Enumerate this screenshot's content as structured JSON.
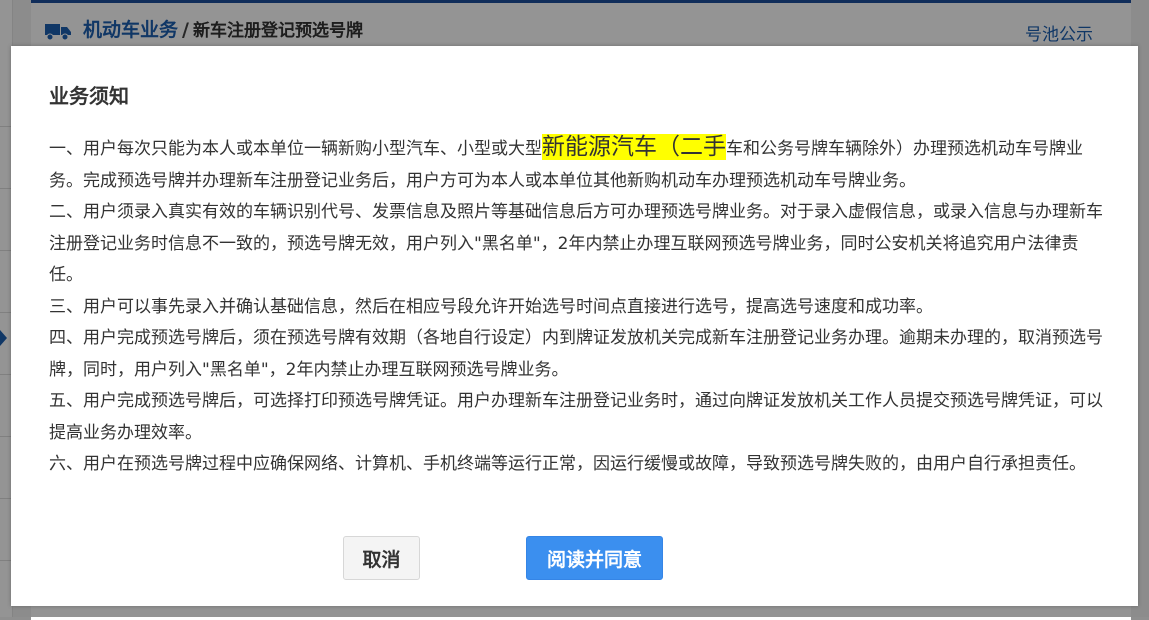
{
  "background": {
    "breadcrumb": {
      "section": "机动车业务",
      "separator": "/",
      "current": "新车注册登记预选号牌"
    },
    "pool_link": "号池公示",
    "icons": [
      "truck-icon"
    ]
  },
  "modal": {
    "title": "业务须知",
    "paragraphs": [
      {
        "before": "一、用户每次只能为本人或本单位一辆新购小型汽车、小型或大型",
        "highlight": "新能源汽车（二手",
        "after": "车和公务号牌车辆除外）办理预选机动车号牌业务。完成预选号牌并办理新车注册登记业务后，用户方可为本人或本单位其他新购机动车办理预选机动车号牌业务。"
      },
      {
        "text": "二、用户须录入真实有效的车辆识别代号、发票信息及照片等基础信息后方可办理预选号牌业务。对于录入虚假信息，或录入信息与办理新车注册登记业务时信息不一致的，预选号牌无效，用户列入\"黑名单\"，2年内禁止办理互联网预选号牌业务，同时公安机关将追究用户法律责任。"
      },
      {
        "text": "三、用户可以事先录入并确认基础信息，然后在相应号段允许开始选号时间点直接进行选号，提高选号速度和成功率。"
      },
      {
        "text": "四、用户完成预选号牌后，须在预选号牌有效期（各地自行设定）内到牌证发放机关完成新车注册登记业务办理。逾期未办理的，取消预选号牌，同时，用户列入\"黑名单\"，2年内禁止办理互联网预选号牌业务。"
      },
      {
        "text": "五、用户完成预选号牌后，可选择打印预选号牌凭证。用户办理新车注册登记业务时，通过向牌证发放机关工作人员提交预选号牌凭证，可以提高业务办理效率。"
      },
      {
        "text": "六、用户在预选号牌过程中应确保网络、计算机、手机终端等运行正常，因运行缓慢或故障，导致预选号牌失败的，由用户自行承担责任。"
      }
    ],
    "buttons": {
      "cancel": "取消",
      "agree": "阅读并同意"
    }
  },
  "colors": {
    "brand_blue": "#1d5fb0",
    "agree_button": "#3b8fef",
    "highlight": "#ffff00"
  }
}
